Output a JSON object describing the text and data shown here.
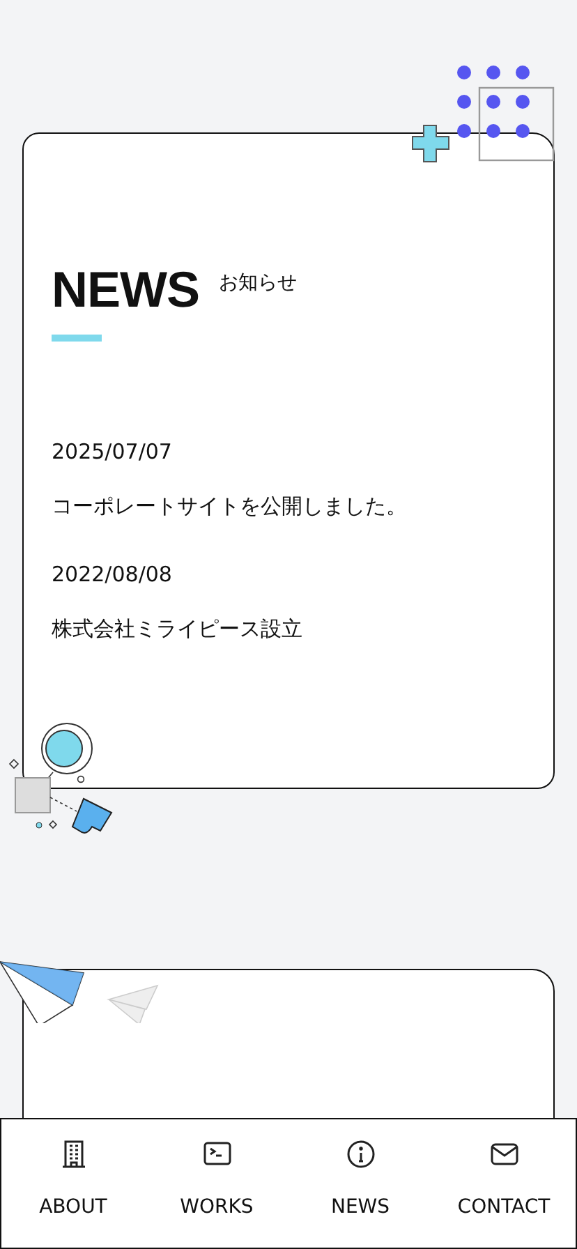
{
  "news": {
    "title": "NEWS",
    "subtitle": "お知らせ",
    "items": [
      {
        "date": "2025/07/07",
        "text": "コーポレートサイトを公開しました。"
      },
      {
        "date": "2022/08/08",
        "text": "株式会社ミライピース設立"
      }
    ]
  },
  "nav": [
    {
      "label": "ABOUT",
      "kind": "building"
    },
    {
      "label": "WORKS",
      "kind": "terminal"
    },
    {
      "label": "NEWS",
      "kind": "info"
    },
    {
      "label": "CONTACT",
      "kind": "mail"
    }
  ]
}
